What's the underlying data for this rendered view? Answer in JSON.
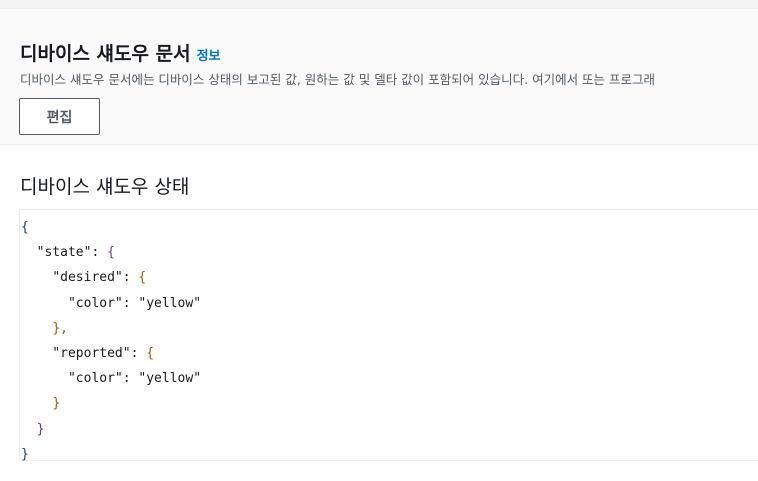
{
  "header": {
    "title": "디바이스 섀도우 문서",
    "info_link": "정보",
    "description": "디바이스 섀도우 문서에는 디바이스 상태의 보고된 값, 원하는 값 및 델타 값이 포함되어 있습니다. 여기에서 또는 프로그래",
    "edit_button": "편집"
  },
  "state_section": {
    "title": "디바이스 섀도우 상태",
    "json_lines": [
      {
        "indent": "",
        "text": "{",
        "cls": "b0"
      },
      {
        "indent": "  ",
        "text": "\"state\": {",
        "cls": "b1"
      },
      {
        "indent": "    ",
        "text": "\"desired\": {",
        "cls": "b2"
      },
      {
        "indent": "      ",
        "text": "\"color\": \"yellow\"",
        "cls": ""
      },
      {
        "indent": "    ",
        "text": "},",
        "cls": "b2"
      },
      {
        "indent": "    ",
        "text": "\"reported\": {",
        "cls": "b2"
      },
      {
        "indent": "      ",
        "text": "\"color\": \"yellow\"",
        "cls": ""
      },
      {
        "indent": "    ",
        "text": "}",
        "cls": "b2"
      },
      {
        "indent": "  ",
        "text": "}",
        "cls": "b1"
      },
      {
        "indent": "",
        "text": "}",
        "cls": "b0"
      }
    ]
  }
}
